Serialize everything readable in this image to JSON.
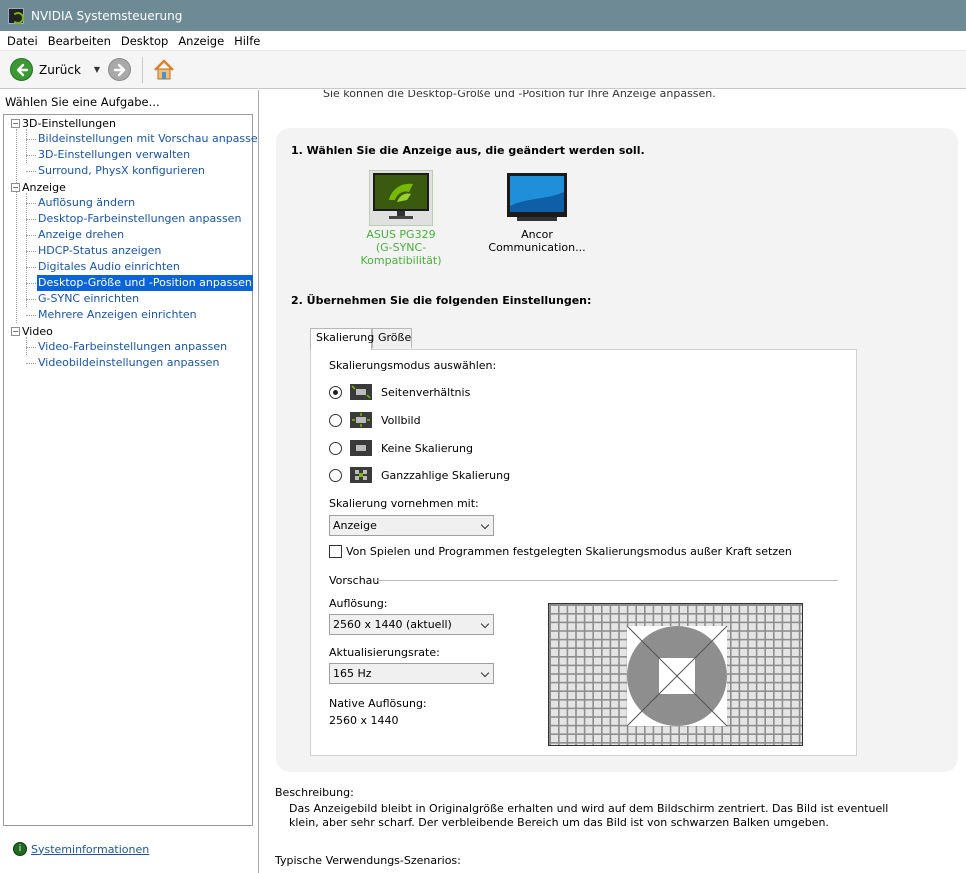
{
  "window": {
    "title": "NVIDIA Systemsteuerung"
  },
  "menu": [
    "Datei",
    "Bearbeiten",
    "Desktop",
    "Anzeige",
    "Hilfe"
  ],
  "toolbar": {
    "back_label": "Zurück"
  },
  "sidebar": {
    "header": "Wählen Sie eine Aufgabe...",
    "categories": [
      {
        "label": "3D-Einstellungen",
        "items": [
          "Bildeinstellungen mit Vorschau anpassen",
          "3D-Einstellungen verwalten",
          "Surround, PhysX konfigurieren"
        ]
      },
      {
        "label": "Anzeige",
        "items": [
          "Auflösung ändern",
          "Desktop-Farbeinstellungen anpassen",
          "Anzeige drehen",
          "HDCP-Status anzeigen",
          "Digitales Audio einrichten",
          "Desktop-Größe und -Position anpassen",
          "G-SYNC einrichten",
          "Mehrere Anzeigen einrichten"
        ]
      },
      {
        "label": "Video",
        "items": [
          "Video-Farbeinstellungen anpassen",
          "Videobildeinstellungen anpassen"
        ]
      }
    ],
    "selected": "Desktop-Größe und -Position anpassen",
    "system_info_link": "Systeminformationen"
  },
  "main": {
    "intro_cut": "Sie können die Desktop-Größe und -Position für Ihre Anzeige anpassen.",
    "step1": "1. Wählen Sie die Anzeige aus, die geändert werden soll.",
    "displays": [
      {
        "name": "ASUS PG329",
        "subtitle": "(G-SYNC-Kompatibilität)",
        "selected": true
      },
      {
        "name": "Ancor Communication...",
        "subtitle": "",
        "selected": false
      }
    ],
    "step2": "2. Übernehmen Sie die folgenden Einstellungen:",
    "tabs": [
      "Skalierung",
      "Größe"
    ],
    "active_tab": "Skalierung",
    "scaling_mode_label": "Skalierungsmodus auswählen:",
    "scaling_modes": [
      {
        "label": "Seitenverhältnis",
        "checked": true
      },
      {
        "label": "Vollbild",
        "checked": false
      },
      {
        "label": "Keine Skalierung",
        "checked": false
      },
      {
        "label": "Ganzzahlige Skalierung",
        "checked": false
      }
    ],
    "perform_scaling_label": "Skalierung vornehmen mit:",
    "perform_scaling_value": "Anzeige",
    "override_label": "Von Spielen und Programmen festgelegten Skalierungsmodus außer Kraft setzen",
    "override_checked": false,
    "preview_label": "Vorschau",
    "resolution_label": "Auflösung:",
    "resolution_value": "2560 x 1440 (aktuell)",
    "refresh_label": "Aktualisierungsrate:",
    "refresh_value": "165 Hz",
    "native_label": "Native Auflösung:",
    "native_value": "2560 x 1440",
    "description_label": "Beschreibung:",
    "description_text": "Das Anzeigebild bleibt in Originalgröße erhalten und wird auf dem Bildschirm zentriert. Das Bild ist eventuell klein, aber sehr scharf. Der verbleibende Bereich um das Bild ist von schwarzen Balken umgeben.",
    "typical_label": "Typische Verwendungs-Szenarios:"
  },
  "colors": {
    "titlebar": "#6e8b95",
    "nvidia_green": "#76b900",
    "link_blue": "#1a55a8",
    "selection_blue": "#0a64d8"
  }
}
